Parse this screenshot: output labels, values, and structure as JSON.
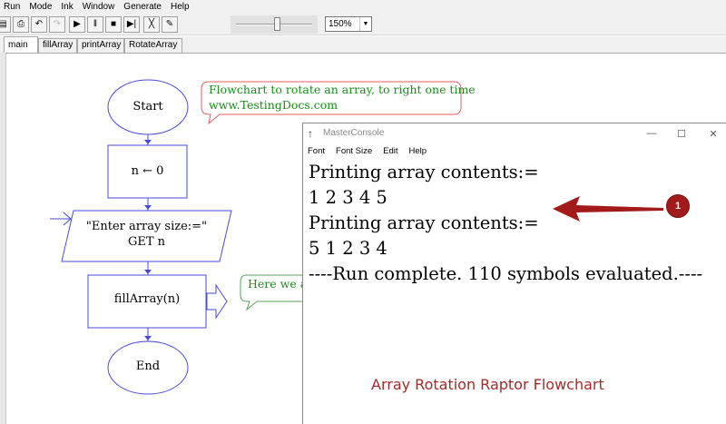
{
  "menu": {
    "items": [
      "Run",
      "Mode",
      "Ink",
      "Window",
      "Generate",
      "Help"
    ]
  },
  "toolbar": {
    "buttons": [
      {
        "icon": "save-icon",
        "glyph": "▤"
      },
      {
        "icon": "print-icon",
        "glyph": "⎙"
      },
      {
        "icon": "undo-icon",
        "glyph": "↶"
      },
      {
        "icon": "redo-icon",
        "glyph": "↷"
      },
      {
        "icon": "play-icon",
        "glyph": "▶"
      },
      {
        "icon": "pause-icon",
        "glyph": "‖"
      },
      {
        "icon": "stop-icon",
        "glyph": "■"
      },
      {
        "icon": "step-icon",
        "glyph": "▶|"
      },
      {
        "icon": "clear-icon",
        "glyph": "╳"
      },
      {
        "icon": "pencil-icon",
        "glyph": "✎"
      }
    ],
    "speed_level": 0.55,
    "zoom_value": "150%"
  },
  "tabs": [
    "main",
    "fillArray",
    "printArray",
    "RotateArray"
  ],
  "flowchart": {
    "start": "Start",
    "assign": "n ← 0",
    "input_prompt": "\"Enter array size:=\"",
    "input_get": "GET n",
    "call": "fillArray(n)",
    "end": "End"
  },
  "comments": {
    "title_line1": "Flowchart to rotate an array, to right one time",
    "title_line2": "www.TestingDocs.com",
    "fill_comment": "Here we ar"
  },
  "console": {
    "title": "MasterConsole",
    "menu": [
      "Font",
      "Font Size",
      "Edit",
      "Help"
    ],
    "lines": [
      "Printing array contents:=",
      "1  2  3  4  5",
      "Printing array contents:=",
      "5  1  2  3  4",
      "----Run complete.  110 symbols evaluated.----"
    ]
  },
  "annotation": {
    "badge": "1",
    "color": "#a21a1a"
  },
  "caption": "Array Rotation Raptor Flowchart",
  "colors": {
    "flow_stroke": "#4a4ad8",
    "comment_text": "#1a8a1a",
    "comment_border": "#e06060",
    "comment_border_2": "#5aa05a",
    "caption": "#a52a2a"
  }
}
